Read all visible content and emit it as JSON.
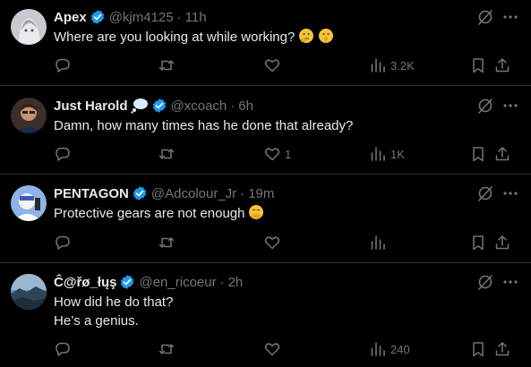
{
  "colors": {
    "background": "#000000",
    "text": "#e7e9ea",
    "secondary": "#71767b",
    "verified": "#1d9bf0",
    "divider": "#2f3336"
  },
  "icons": {
    "verified": "verified-badge-icon",
    "grok": "grok-icon",
    "more": "more-icon",
    "reply": "reply-icon",
    "retweet": "retweet-icon",
    "like": "like-icon",
    "views": "views-icon",
    "bookmark": "bookmark-icon",
    "share": "share-icon"
  },
  "tweets": [
    {
      "name": "Apex",
      "handle": "@kjm4125",
      "separator": "·",
      "time": "11h",
      "text": [
        "Where are you looking at while working?"
      ],
      "emojis": [
        "thinking-face-emoji",
        "shushing-face-emoji"
      ],
      "likes": "",
      "views": "3.2K"
    },
    {
      "name": "Just Harold",
      "name_emoji": "thought-balloon-emoji",
      "handle": "@xcoach",
      "separator": "·",
      "time": "6h",
      "text": [
        "Damn, how many times has he done that already?"
      ],
      "likes": "1",
      "views": "1K"
    },
    {
      "name": "PENTAGON",
      "handle": "@Adcolour_Jr",
      "separator": "·",
      "time": "19m",
      "text": [
        "Protective gears are not enough"
      ],
      "emojis": [
        "face-with-hand-over-mouth-emoji"
      ],
      "likes": "",
      "views": ""
    },
    {
      "name": "Ĉ@řø_łųş",
      "handle": "@en_ricoeur",
      "separator": "·",
      "time": "2h",
      "text": [
        "How did he do that?",
        "He’s a genius."
      ],
      "likes": "",
      "views": "240"
    }
  ]
}
